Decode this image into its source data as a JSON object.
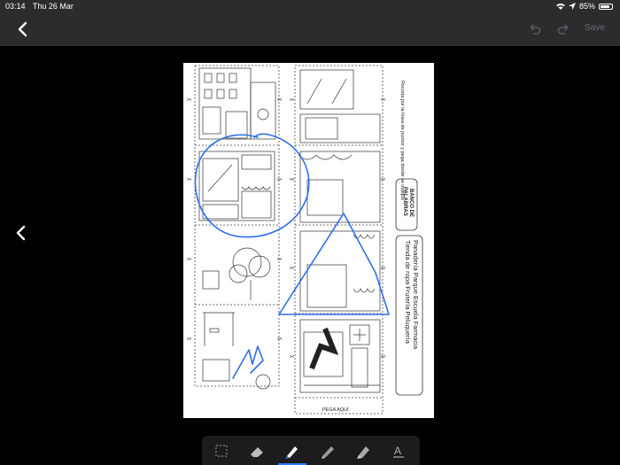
{
  "status_bar": {
    "time": "03:14",
    "date": "Thu 26 Mar",
    "battery": "85%",
    "battery_level": 0.85
  },
  "nav": {
    "save_label": "Save"
  },
  "document": {
    "instructions": "Recorta por la línea de puntos y pega donde se indique",
    "word_bank_title_line1": "BANCO DE",
    "word_bank_title_line2": "PALABRAS",
    "words_line1": "Panadería  Parque  Escuela  Farmacia",
    "words_line2": "Tienda de ropa  Frutería  Peluquería",
    "paste_here": "PEGA AQUÍ"
  },
  "toolbar": {
    "tools": [
      {
        "icon": "lasso-select-icon",
        "selected": false
      },
      {
        "icon": "eraser-icon",
        "selected": false
      },
      {
        "icon": "pen-icon",
        "selected": true
      },
      {
        "icon": "pencil-icon",
        "selected": false
      },
      {
        "icon": "highlighter-icon",
        "selected": false
      },
      {
        "icon": "text-tool-icon",
        "selected": false
      }
    ]
  },
  "colors": {
    "chrome": "#2c2c2e",
    "background": "#000000",
    "accent": "#2f7cf6",
    "annotation": "#2f6fe8"
  }
}
